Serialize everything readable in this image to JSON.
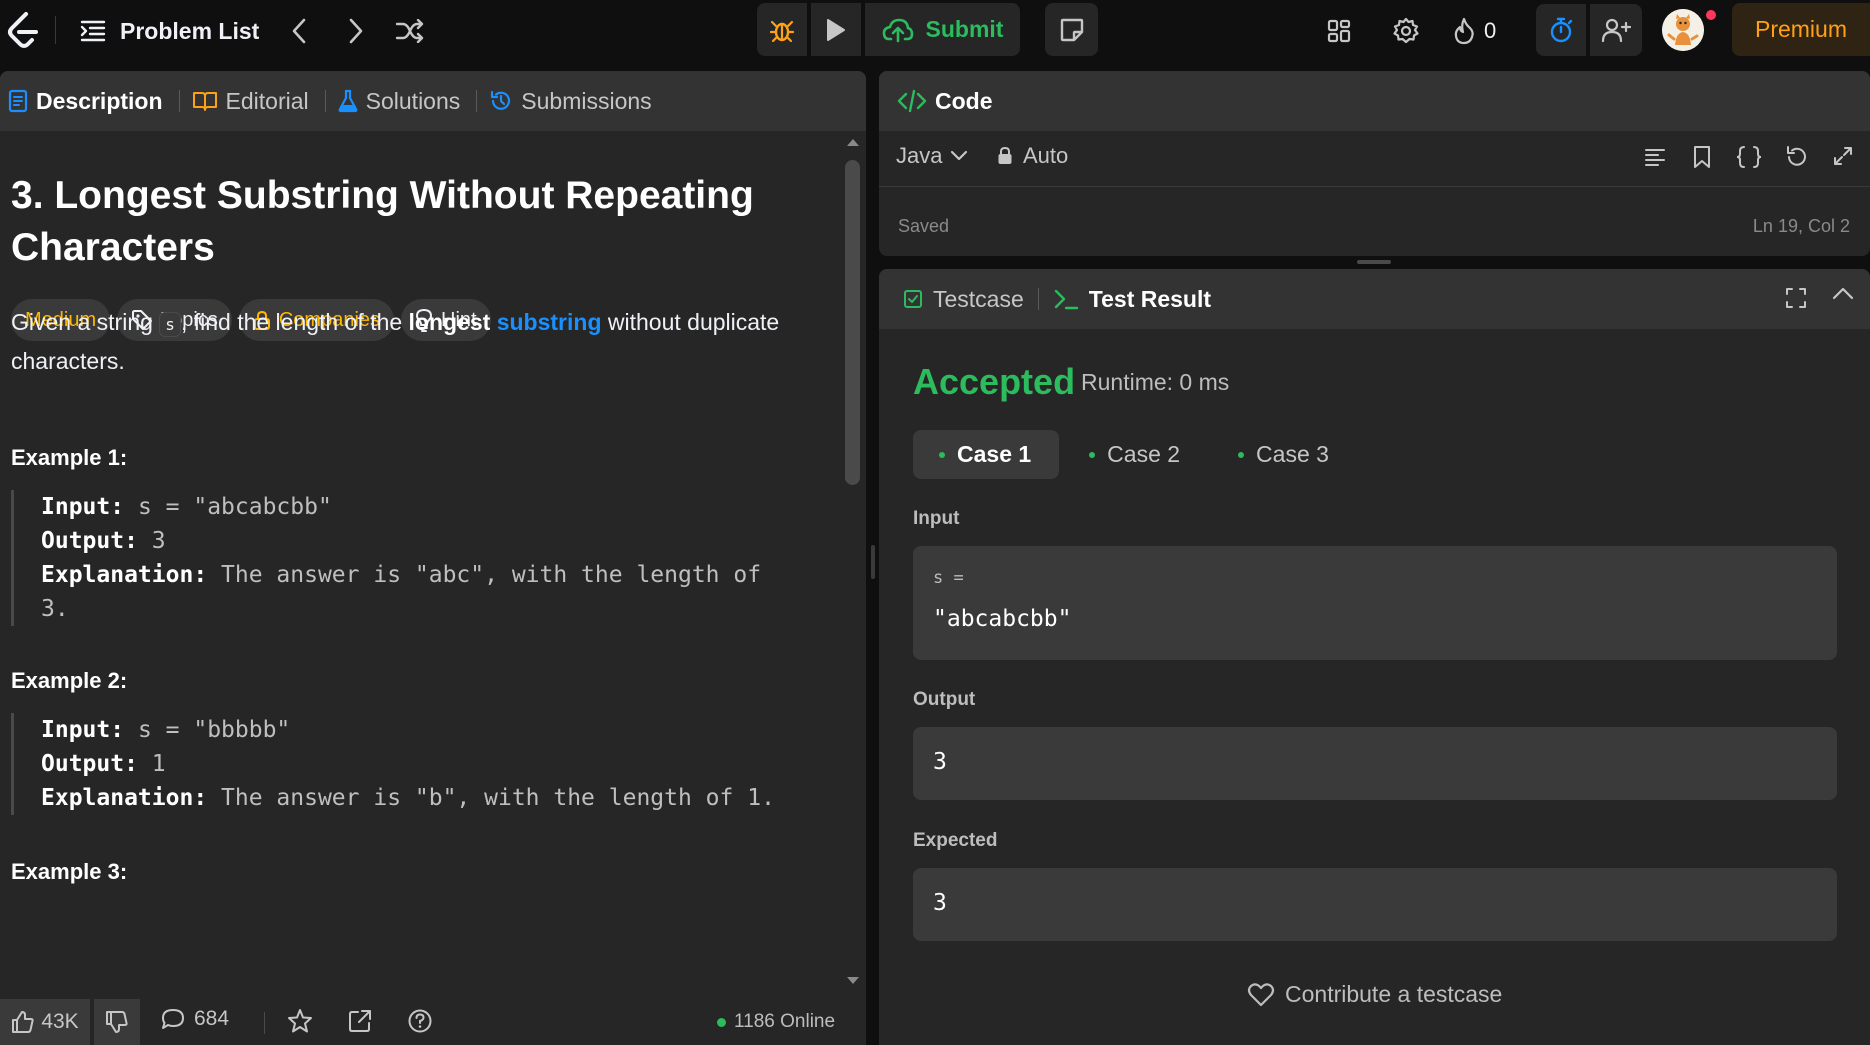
{
  "topbar": {
    "problem_list": "Problem List",
    "submit": "Submit",
    "streak_count": "0",
    "premium": "Premium"
  },
  "description_tabs": [
    {
      "label": "Description"
    },
    {
      "label": "Editorial"
    },
    {
      "label": "Solutions"
    },
    {
      "label": "Submissions"
    }
  ],
  "problem": {
    "title": "3. Longest Substring Without Repeating Characters",
    "difficulty": "Medium",
    "tags": {
      "topics": "Topics",
      "companies": "Companies",
      "hint": "Hint"
    },
    "desc_before": "Given a string ",
    "desc_code": "s",
    "desc_mid": ", find the length of the ",
    "desc_bold": "longest",
    "desc_link": "substring",
    "desc_after": " without duplicate characters."
  },
  "examples": [
    {
      "heading": "Example 1:",
      "input_label": "Input:",
      "input": "s = \"abcabcbb\"",
      "output_label": "Output:",
      "output": "3",
      "explanation_label": "Explanation:",
      "explanation": "The answer is \"abc\", with the length of",
      "explanation_cont": "3."
    },
    {
      "heading": "Example 2:",
      "input_label": "Input:",
      "input": "s = \"bbbbb\"",
      "output_label": "Output:",
      "output": "1",
      "explanation_label": "Explanation:",
      "explanation": "The answer is \"b\", with the length of 1."
    },
    {
      "heading": "Example 3:"
    }
  ],
  "footer": {
    "likes": "43K",
    "comments": "684",
    "online": "1186 Online"
  },
  "code_panel": {
    "title": "Code",
    "language": "Java",
    "mode": "Auto",
    "status": "Saved",
    "cursor": "Ln 19, Col 2"
  },
  "test_panel": {
    "tab_testcase": "Testcase",
    "tab_result": "Test Result",
    "verdict": "Accepted",
    "runtime": "Runtime: 0 ms",
    "cases": [
      {
        "label": "Case 1"
      },
      {
        "label": "Case 2"
      },
      {
        "label": "Case 3"
      }
    ],
    "input_label": "Input",
    "input_var": "s =",
    "input_value": "\"abcabcbb\"",
    "output_label": "Output",
    "output_value": "3",
    "expected_label": "Expected",
    "expected_value": "3",
    "contribute": "Contribute a testcase"
  },
  "colors": {
    "accent_green": "#2cbb5d",
    "medium_yellow": "#ffb800",
    "premium_orange": "#ffa116",
    "link_blue": "#1a90ff",
    "panel_bg": "#262626",
    "page_bg": "#0f0f0f"
  }
}
